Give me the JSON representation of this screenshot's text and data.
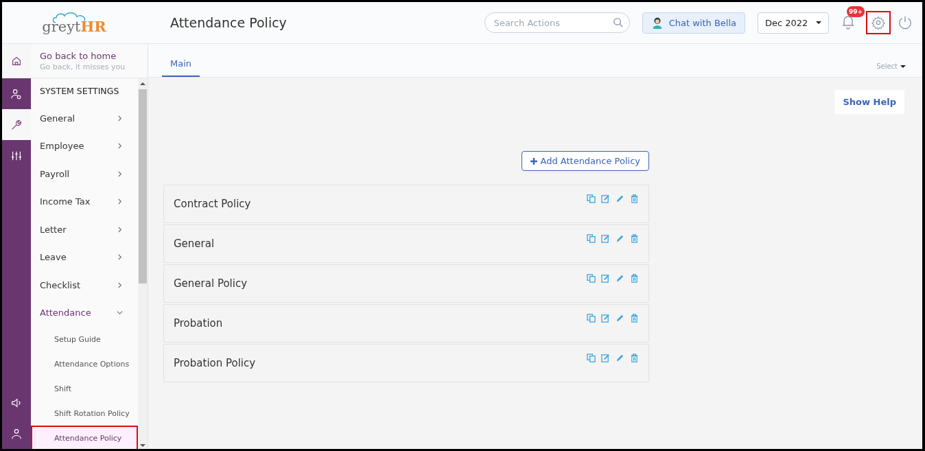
{
  "header": {
    "logo": {
      "left": "greyt",
      "right": "HR"
    },
    "title": "Attendance Policy",
    "search": {
      "placeholder": "Search Actions"
    },
    "chat_button": "Chat with Bella",
    "month_select": "Dec 2022",
    "notification_badge": "99+",
    "settings_highlighted": true
  },
  "rail": [
    {
      "kind": "home",
      "selected": true
    },
    {
      "kind": "person-settings",
      "selected": false
    },
    {
      "kind": "wrench",
      "selected": true
    },
    {
      "kind": "sliders",
      "selected": false
    },
    {
      "kind": "speaker",
      "selected": false
    },
    {
      "kind": "person",
      "selected": false
    }
  ],
  "sidebar": {
    "home_link": {
      "title": "Go back to home",
      "subtitle": "Go back, it misses you"
    },
    "section": "SYSTEM SETTINGS",
    "items": [
      {
        "label": "General",
        "expanded": false
      },
      {
        "label": "Employee",
        "expanded": false
      },
      {
        "label": "Payroll",
        "expanded": false
      },
      {
        "label": "Income Tax",
        "expanded": false
      },
      {
        "label": "Letter",
        "expanded": false
      },
      {
        "label": "Leave",
        "expanded": false
      },
      {
        "label": "Checklist",
        "expanded": false
      },
      {
        "label": "Attendance",
        "expanded": true,
        "children": [
          {
            "label": "Setup Guide",
            "selected": false,
            "highlighted": false
          },
          {
            "label": "Attendance Options",
            "selected": false,
            "highlighted": false
          },
          {
            "label": "Shift",
            "selected": false,
            "highlighted": false
          },
          {
            "label": "Shift Rotation Policy",
            "selected": false,
            "highlighted": false
          },
          {
            "label": "Attendance Policy",
            "selected": true,
            "highlighted": true
          }
        ]
      }
    ]
  },
  "tabs": [
    {
      "label": "Main",
      "selected": true
    }
  ],
  "select_menu": "Select",
  "show_help": "Show Help",
  "add_button": "Add Attendance Policy",
  "policies": [
    {
      "name": "Contract Policy"
    },
    {
      "name": "General"
    },
    {
      "name": "General Policy"
    },
    {
      "name": "Probation"
    },
    {
      "name": "Probation Policy"
    }
  ]
}
